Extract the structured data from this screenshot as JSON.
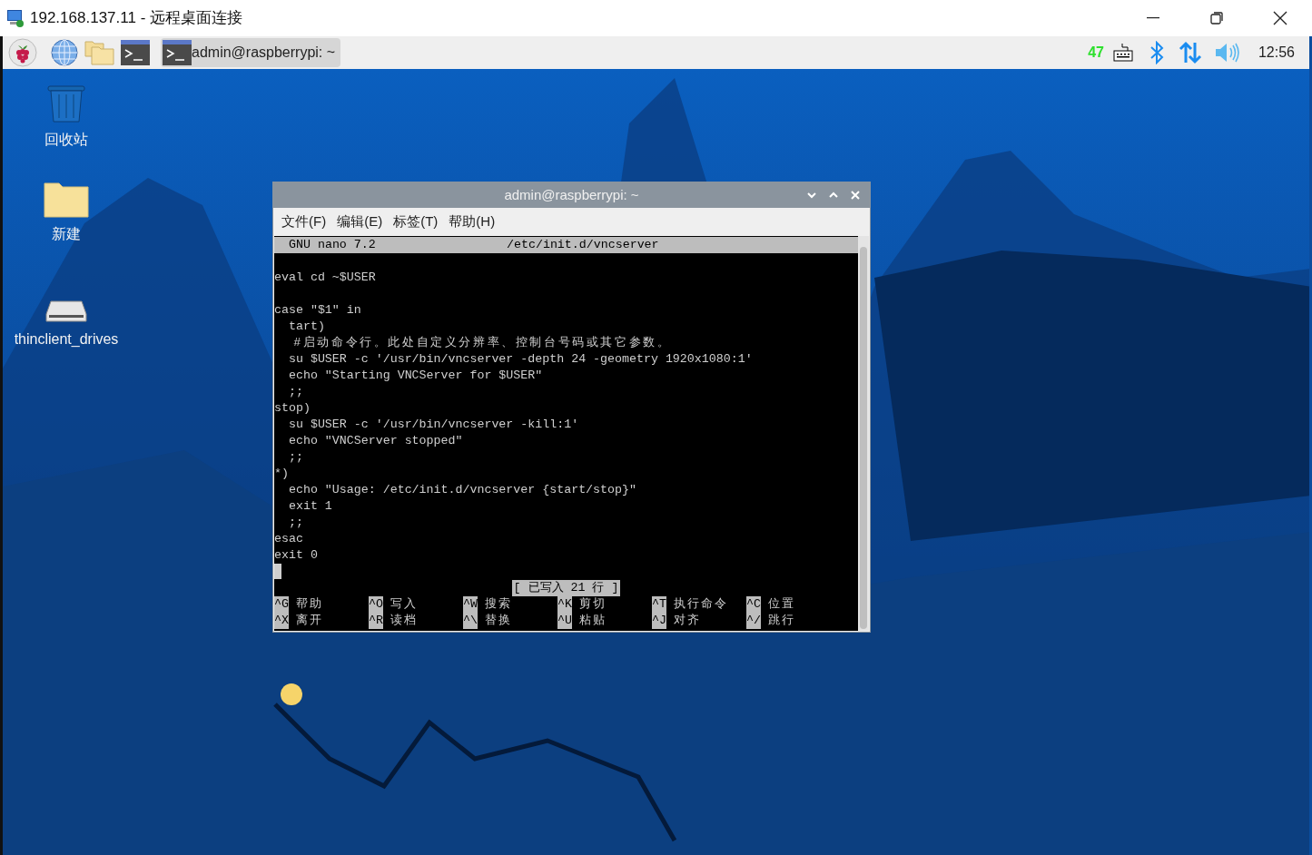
{
  "window": {
    "title": "192.168.137.11 - 远程桌面连接"
  },
  "taskbar": {
    "task_button": {
      "label": "admin@raspberrypi: ~",
      "selected": true
    },
    "cpu": "47",
    "clock": "12:56"
  },
  "desktop_icons": [
    {
      "kind": "trash",
      "label": "回收站"
    },
    {
      "kind": "folder",
      "label": "新建"
    },
    {
      "kind": "drive",
      "label": "thinclient_drives"
    }
  ],
  "terminal": {
    "title": "admin@raspberrypi: ~",
    "menu": [
      "文件(F)",
      "编辑(E)",
      "标签(T)",
      "帮助(H)"
    ],
    "header_left": "GNU nano 7.2",
    "header_file": "/etc/init.d/vncserver",
    "blocks": [
      [
        "eval cd ~$USER"
      ],
      [
        "case \"$1\" in",
        "  tart)",
        "  #启动命令行。此处自定义分辨率、控制台号码或其它参数。",
        "  su $USER -c '/usr/bin/vncserver -depth 24 -geometry 1920x1080:1'",
        "  echo \"Starting VNCServer for $USER\"",
        "  ;;",
        "stop)",
        "  su $USER -c '/usr/bin/vncserver -kill:1'",
        "  echo \"VNCServer stopped\"",
        "  ;;",
        "*)",
        "  echo \"Usage: /etc/init.d/vncserver {start/stop}\"",
        "  exit 1",
        "  ;;",
        "esac",
        "exit 0"
      ]
    ],
    "status": "[ 已写入 21 行 ]",
    "shortcuts": [
      [
        {
          "key": "^G",
          "label": "帮助"
        },
        {
          "key": "^O",
          "label": "写入"
        },
        {
          "key": "^W",
          "label": "搜索"
        },
        {
          "key": "^K",
          "label": "剪切"
        },
        {
          "key": "^T",
          "label": "执行命令"
        },
        {
          "key": "^C",
          "label": "位置"
        }
      ],
      [
        {
          "key": "^X",
          "label": "离开"
        },
        {
          "key": "^R",
          "label": "读档"
        },
        {
          "key": "^\\",
          "label": "替换"
        },
        {
          "key": "^U",
          "label": "粘贴"
        },
        {
          "key": "^J",
          "label": "对齐"
        },
        {
          "key": "^/",
          "label": "跳行"
        }
      ]
    ]
  }
}
